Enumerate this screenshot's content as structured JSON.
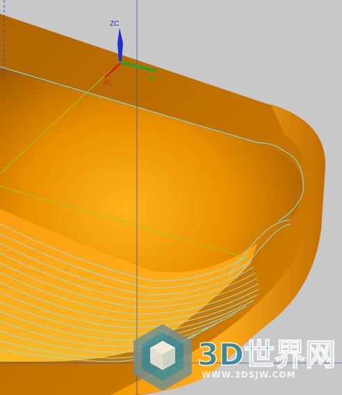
{
  "viewport": {
    "background": "#c8c8c8",
    "part_color": "#e08a00",
    "toolpath_color": "#7fd8e8",
    "guide_color": "#9ccc2a"
  },
  "wcs": {
    "zc_label": "ZC",
    "yc_label": "YC",
    "xc_label": "XC",
    "z_color": "#1f2fd0",
    "y_color": "#2aa02a",
    "x_color": "#d02020"
  },
  "watermark": {
    "logo_icon": "cube-logo-icon",
    "brand": "3D世界网",
    "url": "WWW.3DSJW.COM"
  }
}
